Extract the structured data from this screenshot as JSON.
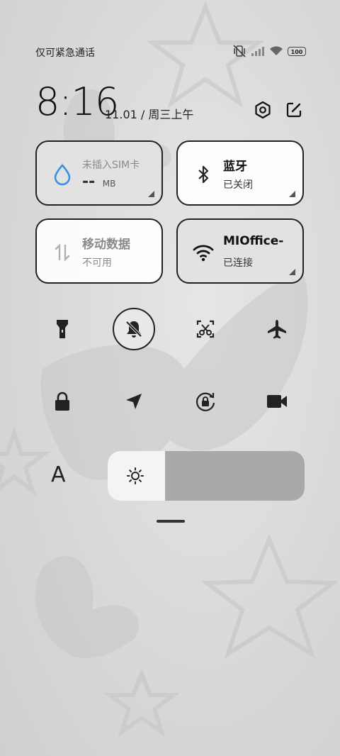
{
  "status_bar": {
    "carrier": "仅可紧急通话",
    "battery": "100"
  },
  "header": {
    "time": "8:16",
    "date": "11.01 / 周三上午"
  },
  "tiles": [
    {
      "title": "未插入SIM卡",
      "value": "--",
      "unit": "MB",
      "state": "disabled"
    },
    {
      "title": "蓝牙",
      "sub": "已关闭",
      "state": "off"
    },
    {
      "title": "移动数据",
      "sub": "不可用",
      "state": "disabled"
    },
    {
      "title": "MIOffice-",
      "sub": "已连接",
      "state": "on"
    }
  ],
  "toggles": [
    {
      "icon": "flashlight-icon",
      "active": false
    },
    {
      "icon": "mute-bell-icon",
      "active": true
    },
    {
      "icon": "screenshot-scissors-icon",
      "active": false
    },
    {
      "icon": "airplane-icon",
      "active": false
    },
    {
      "icon": "lock-icon",
      "active": false
    },
    {
      "icon": "location-icon",
      "active": false
    },
    {
      "icon": "auto-rotate-lock-icon",
      "active": false
    },
    {
      "icon": "screen-record-icon",
      "active": false
    }
  ],
  "brightness": {
    "font_button": "A",
    "level": 0.29
  },
  "colors": {
    "accent_blue": "#3a8ee6",
    "tile_border": "#222222"
  }
}
